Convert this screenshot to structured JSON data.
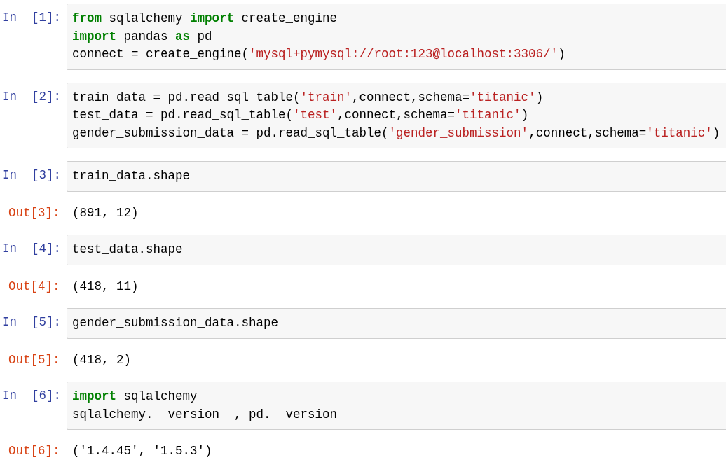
{
  "cells": [
    {
      "prompt": "In  [1]:",
      "code": [
        [
          {
            "kind": "keyword",
            "text": "from"
          },
          {
            "kind": "plain",
            "text": " sqlalchemy "
          },
          {
            "kind": "keyword",
            "text": "import"
          },
          {
            "kind": "plain",
            "text": " create_engine"
          }
        ],
        [
          {
            "kind": "keyword",
            "text": "import"
          },
          {
            "kind": "plain",
            "text": " pandas "
          },
          {
            "kind": "keyword",
            "text": "as"
          },
          {
            "kind": "plain",
            "text": " pd"
          }
        ],
        [
          {
            "kind": "plain",
            "text": "connect = create_engine("
          },
          {
            "kind": "string",
            "text": "'mysql+pymysql://root:123@localhost:3306/'"
          },
          {
            "kind": "plain",
            "text": ")"
          }
        ]
      ]
    },
    {
      "prompt": "In  [2]:",
      "code": [
        [
          {
            "kind": "plain",
            "text": "train_data = pd.read_sql_table("
          },
          {
            "kind": "string",
            "text": "'train'"
          },
          {
            "kind": "plain",
            "text": ",connect,schema="
          },
          {
            "kind": "string",
            "text": "'titanic'"
          },
          {
            "kind": "plain",
            "text": ")"
          }
        ],
        [
          {
            "kind": "plain",
            "text": "test_data = pd.read_sql_table("
          },
          {
            "kind": "string",
            "text": "'test'"
          },
          {
            "kind": "plain",
            "text": ",connect,schema="
          },
          {
            "kind": "string",
            "text": "'titanic'"
          },
          {
            "kind": "plain",
            "text": ")"
          }
        ],
        [
          {
            "kind": "plain",
            "text": "gender_submission_data = pd.read_sql_table("
          },
          {
            "kind": "string",
            "text": "'gender_submission'"
          },
          {
            "kind": "plain",
            "text": ",connect,schema="
          },
          {
            "kind": "string",
            "text": "'titanic'"
          },
          {
            "kind": "plain",
            "text": ")"
          }
        ]
      ]
    },
    {
      "prompt": "In  [3]:",
      "code": [
        [
          {
            "kind": "plain",
            "text": "train_data.shape"
          }
        ]
      ],
      "out_prompt": "Out[3]:",
      "output": "(891, 12)"
    },
    {
      "prompt": "In  [4]:",
      "code": [
        [
          {
            "kind": "plain",
            "text": "test_data.shape"
          }
        ]
      ],
      "out_prompt": "Out[4]:",
      "output": "(418, 11)"
    },
    {
      "prompt": "In  [5]:",
      "code": [
        [
          {
            "kind": "plain",
            "text": "gender_submission_data.shape"
          }
        ]
      ],
      "out_prompt": "Out[5]:",
      "output": "(418, 2)"
    },
    {
      "prompt": "In  [6]:",
      "code": [
        [
          {
            "kind": "keyword",
            "text": "import"
          },
          {
            "kind": "plain",
            "text": " sqlalchemy"
          }
        ],
        [
          {
            "kind": "plain",
            "text": "sqlalchemy.__version__, pd.__version__"
          }
        ]
      ],
      "out_prompt": "Out[6]:",
      "output": "('1.4.45', '1.5.3')"
    }
  ]
}
